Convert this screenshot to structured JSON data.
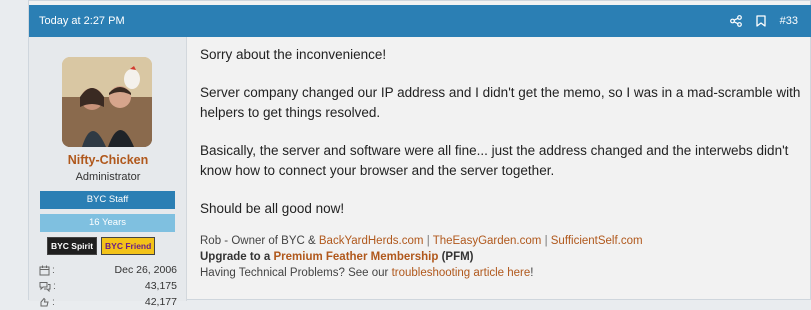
{
  "header": {
    "timestamp": "Today at 2:27 PM",
    "post_number": "#33",
    "share_icon": "share-icon",
    "bookmark_icon": "bookmark-icon"
  },
  "user": {
    "name": "Nifty-Chicken",
    "title": "Administrator",
    "staff_banner": "BYC Staff",
    "years_banner": "16 Years",
    "badges": [
      "BYC Spirit",
      "BYC Friend"
    ],
    "stats": [
      {
        "icon": "calendar-icon",
        "value": "Dec 26, 2006"
      },
      {
        "icon": "messages-icon",
        "value": "43,175"
      },
      {
        "icon": "reactions-icon",
        "value": "42,177"
      }
    ]
  },
  "message": {
    "paragraphs": [
      "Sorry about the inconvenience!",
      "Server company changed our IP address and I didn't get the memo, so I was in a mad-scramble with helpers to get things resolved.",
      "Basically, the server and software were all fine... just the address changed and the interwebs didn't know how to connect your browser and the server together.",
      "Should be all good now!"
    ]
  },
  "signature": {
    "line1_prefix": "Rob - Owner of BYC & ",
    "links": [
      "BackYardHerds.com",
      "TheEasyGarden.com",
      "SufficientSelf.com"
    ],
    "separator": "|",
    "line2_prefix": "Upgrade to a ",
    "line2_link": "Premium Feather Membership",
    "line2_suffix": " (PFM)",
    "line3_prefix": "Having Technical Problems? See our ",
    "line3_link": "troubleshooting article here",
    "line3_suffix": "!"
  },
  "colors": {
    "header_bg": "#2b7fb4",
    "link": "#b0581c",
    "username": "#b0581c",
    "staff_banner": "#2b7fb4",
    "years_banner": "#7fc0e0"
  }
}
